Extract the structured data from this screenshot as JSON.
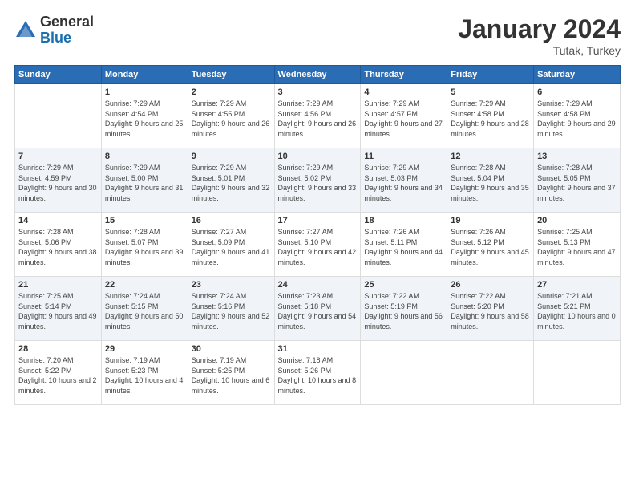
{
  "logo": {
    "general": "General",
    "blue": "Blue"
  },
  "header": {
    "title": "January 2024",
    "subtitle": "Tutak, Turkey"
  },
  "days_of_week": [
    "Sunday",
    "Monday",
    "Tuesday",
    "Wednesday",
    "Thursday",
    "Friday",
    "Saturday"
  ],
  "weeks": [
    [
      {
        "day": "",
        "sunrise": "",
        "sunset": "",
        "daylight": ""
      },
      {
        "day": "1",
        "sunrise": "Sunrise: 7:29 AM",
        "sunset": "Sunset: 4:54 PM",
        "daylight": "Daylight: 9 hours and 25 minutes."
      },
      {
        "day": "2",
        "sunrise": "Sunrise: 7:29 AM",
        "sunset": "Sunset: 4:55 PM",
        "daylight": "Daylight: 9 hours and 26 minutes."
      },
      {
        "day": "3",
        "sunrise": "Sunrise: 7:29 AM",
        "sunset": "Sunset: 4:56 PM",
        "daylight": "Daylight: 9 hours and 26 minutes."
      },
      {
        "day": "4",
        "sunrise": "Sunrise: 7:29 AM",
        "sunset": "Sunset: 4:57 PM",
        "daylight": "Daylight: 9 hours and 27 minutes."
      },
      {
        "day": "5",
        "sunrise": "Sunrise: 7:29 AM",
        "sunset": "Sunset: 4:58 PM",
        "daylight": "Daylight: 9 hours and 28 minutes."
      },
      {
        "day": "6",
        "sunrise": "Sunrise: 7:29 AM",
        "sunset": "Sunset: 4:58 PM",
        "daylight": "Daylight: 9 hours and 29 minutes."
      }
    ],
    [
      {
        "day": "7",
        "sunrise": "Sunrise: 7:29 AM",
        "sunset": "Sunset: 4:59 PM",
        "daylight": "Daylight: 9 hours and 30 minutes."
      },
      {
        "day": "8",
        "sunrise": "Sunrise: 7:29 AM",
        "sunset": "Sunset: 5:00 PM",
        "daylight": "Daylight: 9 hours and 31 minutes."
      },
      {
        "day": "9",
        "sunrise": "Sunrise: 7:29 AM",
        "sunset": "Sunset: 5:01 PM",
        "daylight": "Daylight: 9 hours and 32 minutes."
      },
      {
        "day": "10",
        "sunrise": "Sunrise: 7:29 AM",
        "sunset": "Sunset: 5:02 PM",
        "daylight": "Daylight: 9 hours and 33 minutes."
      },
      {
        "day": "11",
        "sunrise": "Sunrise: 7:29 AM",
        "sunset": "Sunset: 5:03 PM",
        "daylight": "Daylight: 9 hours and 34 minutes."
      },
      {
        "day": "12",
        "sunrise": "Sunrise: 7:28 AM",
        "sunset": "Sunset: 5:04 PM",
        "daylight": "Daylight: 9 hours and 35 minutes."
      },
      {
        "day": "13",
        "sunrise": "Sunrise: 7:28 AM",
        "sunset": "Sunset: 5:05 PM",
        "daylight": "Daylight: 9 hours and 37 minutes."
      }
    ],
    [
      {
        "day": "14",
        "sunrise": "Sunrise: 7:28 AM",
        "sunset": "Sunset: 5:06 PM",
        "daylight": "Daylight: 9 hours and 38 minutes."
      },
      {
        "day": "15",
        "sunrise": "Sunrise: 7:28 AM",
        "sunset": "Sunset: 5:07 PM",
        "daylight": "Daylight: 9 hours and 39 minutes."
      },
      {
        "day": "16",
        "sunrise": "Sunrise: 7:27 AM",
        "sunset": "Sunset: 5:09 PM",
        "daylight": "Daylight: 9 hours and 41 minutes."
      },
      {
        "day": "17",
        "sunrise": "Sunrise: 7:27 AM",
        "sunset": "Sunset: 5:10 PM",
        "daylight": "Daylight: 9 hours and 42 minutes."
      },
      {
        "day": "18",
        "sunrise": "Sunrise: 7:26 AM",
        "sunset": "Sunset: 5:11 PM",
        "daylight": "Daylight: 9 hours and 44 minutes."
      },
      {
        "day": "19",
        "sunrise": "Sunrise: 7:26 AM",
        "sunset": "Sunset: 5:12 PM",
        "daylight": "Daylight: 9 hours and 45 minutes."
      },
      {
        "day": "20",
        "sunrise": "Sunrise: 7:25 AM",
        "sunset": "Sunset: 5:13 PM",
        "daylight": "Daylight: 9 hours and 47 minutes."
      }
    ],
    [
      {
        "day": "21",
        "sunrise": "Sunrise: 7:25 AM",
        "sunset": "Sunset: 5:14 PM",
        "daylight": "Daylight: 9 hours and 49 minutes."
      },
      {
        "day": "22",
        "sunrise": "Sunrise: 7:24 AM",
        "sunset": "Sunset: 5:15 PM",
        "daylight": "Daylight: 9 hours and 50 minutes."
      },
      {
        "day": "23",
        "sunrise": "Sunrise: 7:24 AM",
        "sunset": "Sunset: 5:16 PM",
        "daylight": "Daylight: 9 hours and 52 minutes."
      },
      {
        "day": "24",
        "sunrise": "Sunrise: 7:23 AM",
        "sunset": "Sunset: 5:18 PM",
        "daylight": "Daylight: 9 hours and 54 minutes."
      },
      {
        "day": "25",
        "sunrise": "Sunrise: 7:22 AM",
        "sunset": "Sunset: 5:19 PM",
        "daylight": "Daylight: 9 hours and 56 minutes."
      },
      {
        "day": "26",
        "sunrise": "Sunrise: 7:22 AM",
        "sunset": "Sunset: 5:20 PM",
        "daylight": "Daylight: 9 hours and 58 minutes."
      },
      {
        "day": "27",
        "sunrise": "Sunrise: 7:21 AM",
        "sunset": "Sunset: 5:21 PM",
        "daylight": "Daylight: 10 hours and 0 minutes."
      }
    ],
    [
      {
        "day": "28",
        "sunrise": "Sunrise: 7:20 AM",
        "sunset": "Sunset: 5:22 PM",
        "daylight": "Daylight: 10 hours and 2 minutes."
      },
      {
        "day": "29",
        "sunrise": "Sunrise: 7:19 AM",
        "sunset": "Sunset: 5:23 PM",
        "daylight": "Daylight: 10 hours and 4 minutes."
      },
      {
        "day": "30",
        "sunrise": "Sunrise: 7:19 AM",
        "sunset": "Sunset: 5:25 PM",
        "daylight": "Daylight: 10 hours and 6 minutes."
      },
      {
        "day": "31",
        "sunrise": "Sunrise: 7:18 AM",
        "sunset": "Sunset: 5:26 PM",
        "daylight": "Daylight: 10 hours and 8 minutes."
      },
      {
        "day": "",
        "sunrise": "",
        "sunset": "",
        "daylight": ""
      },
      {
        "day": "",
        "sunrise": "",
        "sunset": "",
        "daylight": ""
      },
      {
        "day": "",
        "sunrise": "",
        "sunset": "",
        "daylight": ""
      }
    ]
  ]
}
